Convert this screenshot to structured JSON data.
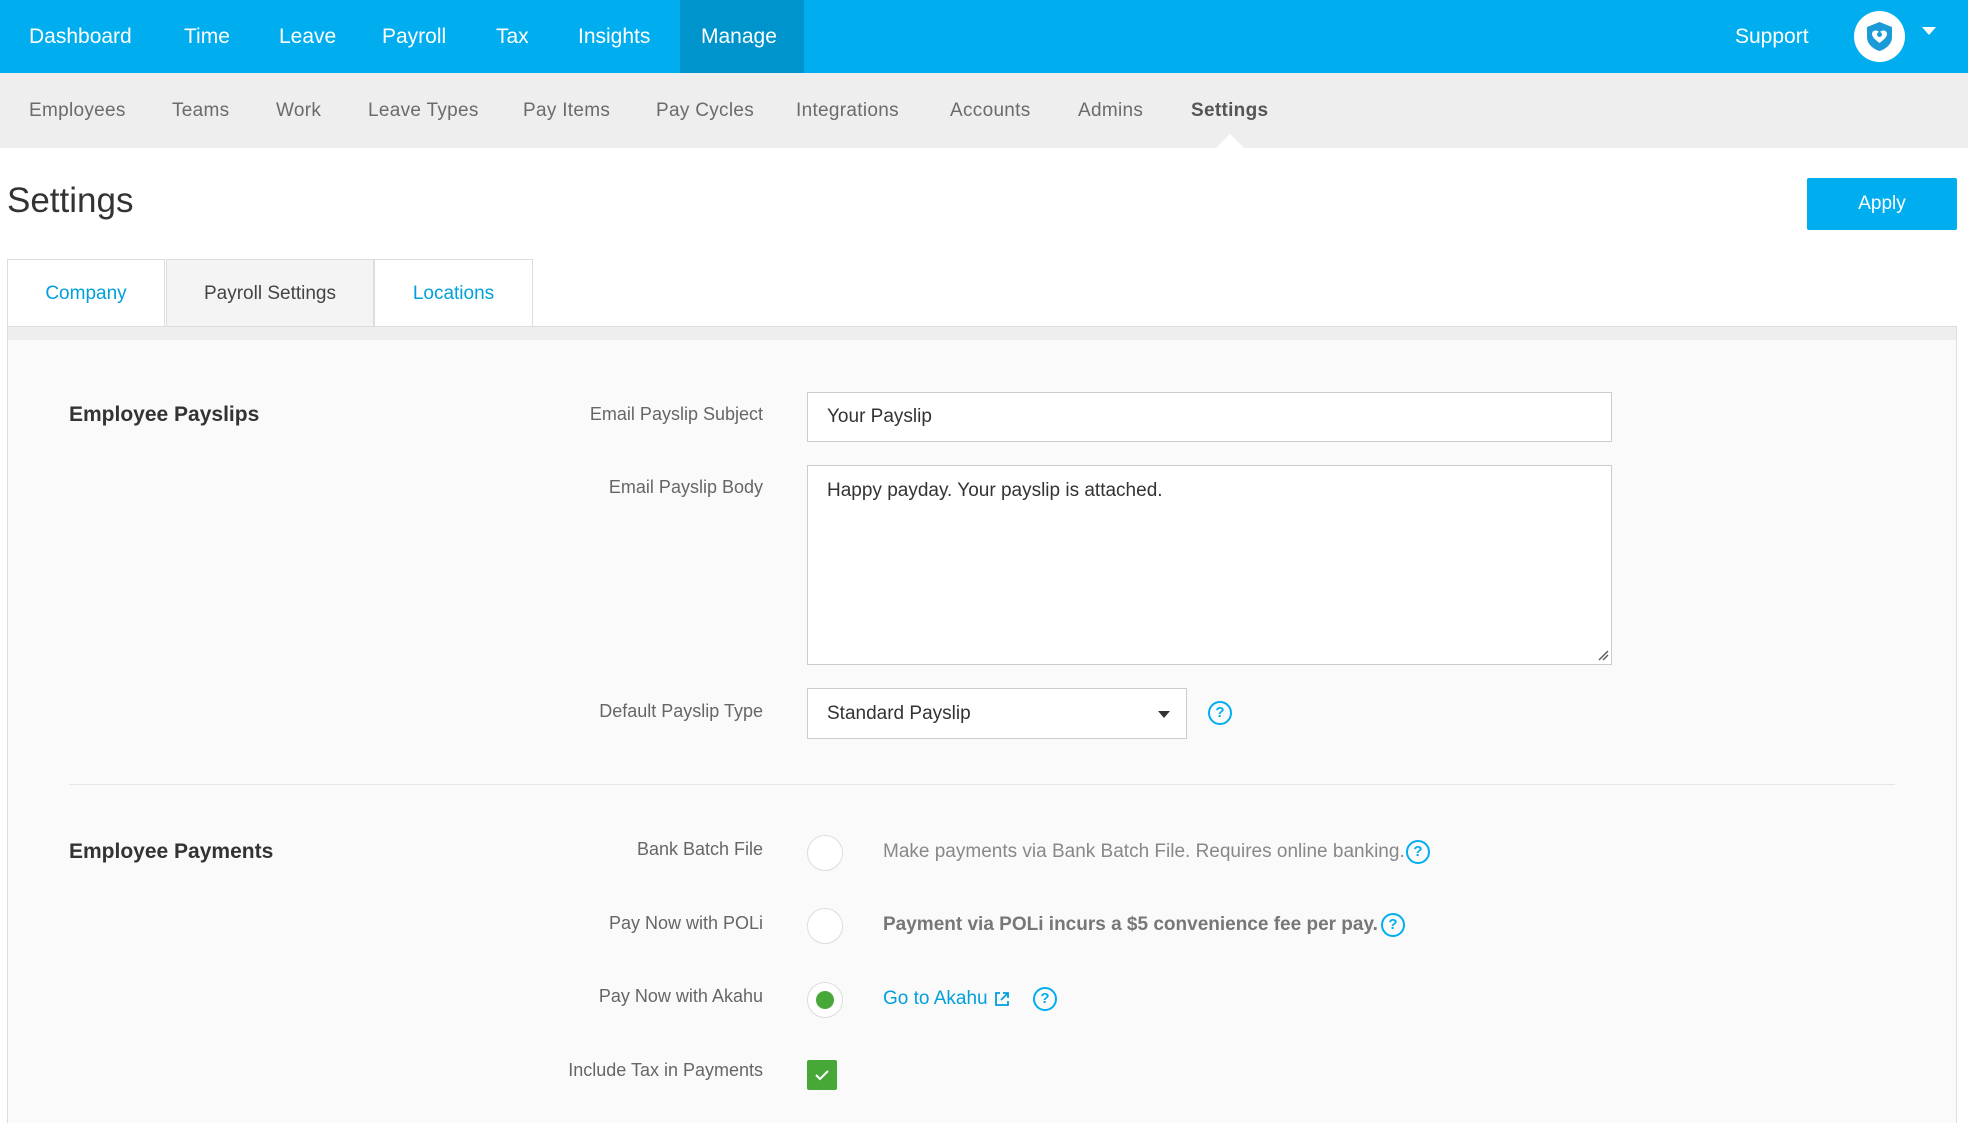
{
  "topnav": {
    "items": [
      {
        "label": "Dashboard"
      },
      {
        "label": "Time"
      },
      {
        "label": "Leave"
      },
      {
        "label": "Payroll"
      },
      {
        "label": "Tax"
      },
      {
        "label": "Insights"
      },
      {
        "label": "Manage"
      }
    ],
    "support_label": "Support",
    "accent_color": "#00aeef",
    "active_color": "#0094cc"
  },
  "subnav": {
    "items": [
      {
        "label": "Employees"
      },
      {
        "label": "Teams"
      },
      {
        "label": "Work"
      },
      {
        "label": "Leave Types"
      },
      {
        "label": "Pay Items"
      },
      {
        "label": "Pay Cycles"
      },
      {
        "label": "Integrations"
      },
      {
        "label": "Accounts"
      },
      {
        "label": "Admins"
      },
      {
        "label": "Settings"
      }
    ]
  },
  "page": {
    "title": "Settings",
    "apply_label": "Apply"
  },
  "tabs": [
    {
      "label": "Company"
    },
    {
      "label": "Payroll Settings"
    },
    {
      "label": "Locations"
    }
  ],
  "payslips": {
    "section_title": "Employee Payslips",
    "subject_label": "Email Payslip Subject",
    "subject_value": "Your Payslip",
    "body_label": "Email Payslip Body",
    "body_value": "Happy payday. Your payslip is attached.",
    "type_label": "Default Payslip Type",
    "type_value": "Standard Payslip",
    "help_glyph": "?"
  },
  "payments": {
    "section_title": "Employee Payments",
    "bank_batch_label": "Bank Batch File",
    "bank_batch_text": "Make payments via Bank Batch File. Requires online banking.",
    "poli_label": "Pay Now with POLi",
    "poli_text": "Payment via POLi incurs a $5 convenience fee per pay.",
    "akahu_label": "Pay Now with Akahu",
    "akahu_link": "Go to Akahu",
    "tax_label": "Include Tax in Payments",
    "selected_color": "#47a838"
  }
}
